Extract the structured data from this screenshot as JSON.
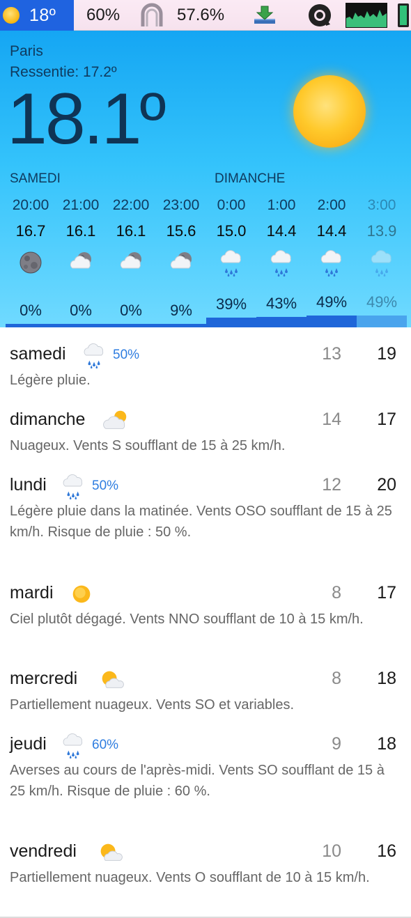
{
  "menubar": {
    "weather_temp": "18º",
    "battery_pct": "60%",
    "memory_pct": "57.6%",
    "icons": [
      "sun-icon",
      "headphones-icon",
      "download-icon",
      "avast-icon",
      "cpu-graph-icon",
      "battery-icon"
    ]
  },
  "current": {
    "city": "Paris",
    "feels_like": "Ressentie: 17.2º",
    "temperature": "18.1º",
    "condition_icon": "sun-icon"
  },
  "hourly": {
    "day1_label": "SAMEDI",
    "day2_label": "DIMANCHE",
    "hours": [
      {
        "time": "20:00",
        "temp": "16.7",
        "icon": "moon-icon",
        "precip": "0%",
        "precip_value": 0
      },
      {
        "time": "21:00",
        "temp": "16.1",
        "icon": "moon-cloud-icon",
        "precip": "0%",
        "precip_value": 0
      },
      {
        "time": "22:00",
        "temp": "16.1",
        "icon": "moon-cloud-icon",
        "precip": "0%",
        "precip_value": 0
      },
      {
        "time": "23:00",
        "temp": "15.6",
        "icon": "moon-cloud-icon",
        "precip": "9%",
        "precip_value": 9
      },
      {
        "time": "0:00",
        "temp": "15.0",
        "icon": "rain-icon",
        "precip": "39%",
        "precip_value": 39
      },
      {
        "time": "1:00",
        "temp": "14.4",
        "icon": "rain-icon",
        "precip": "43%",
        "precip_value": 43
      },
      {
        "time": "2:00",
        "temp": "14.4",
        "icon": "rain-icon",
        "precip": "49%",
        "precip_value": 49
      },
      {
        "time": "3:00",
        "temp": "13.9",
        "icon": "rain-icon",
        "precip": "49%",
        "precip_value": 49
      }
    ]
  },
  "daily": [
    {
      "day": "samedi",
      "icon": "rain-icon",
      "precip": "50%",
      "low": "13",
      "high": "19",
      "desc": "Légère pluie."
    },
    {
      "day": "dimanche",
      "icon": "partly-cloudy-icon",
      "precip": "",
      "low": "14",
      "high": "17",
      "desc": "Nuageux. Vents S soufflant de 15 à 25 km/h."
    },
    {
      "day": "lundi",
      "icon": "rain-icon",
      "precip": "50%",
      "low": "12",
      "high": "20",
      "desc": "Légère pluie dans la matinée. Vents OSO soufflant de 15 à 25 km/h. Risque de pluie : 50 %."
    },
    {
      "day": "mardi",
      "icon": "sun-icon",
      "precip": "",
      "low": "8",
      "high": "17",
      "desc": "Ciel plutôt dégagé. Vents NNO soufflant de 10 à 15 km/h."
    },
    {
      "day": "mercredi",
      "icon": "partly-sunny-icon",
      "precip": "",
      "low": "8",
      "high": "18",
      "desc": "Partiellement nuageux. Vents SO et variables."
    },
    {
      "day": "jeudi",
      "icon": "rain-icon",
      "precip": "60%",
      "low": "9",
      "high": "18",
      "desc": "Averses au cours de l'après-midi. Vents SO soufflant de 15 à 25 km/h. Risque de pluie : 60 %."
    },
    {
      "day": "vendredi",
      "icon": "partly-sunny-icon",
      "precip": "",
      "low": "10",
      "high": "16",
      "desc": "Partiellement nuageux. Vents O soufflant de 10 à 15 km/h."
    }
  ]
}
